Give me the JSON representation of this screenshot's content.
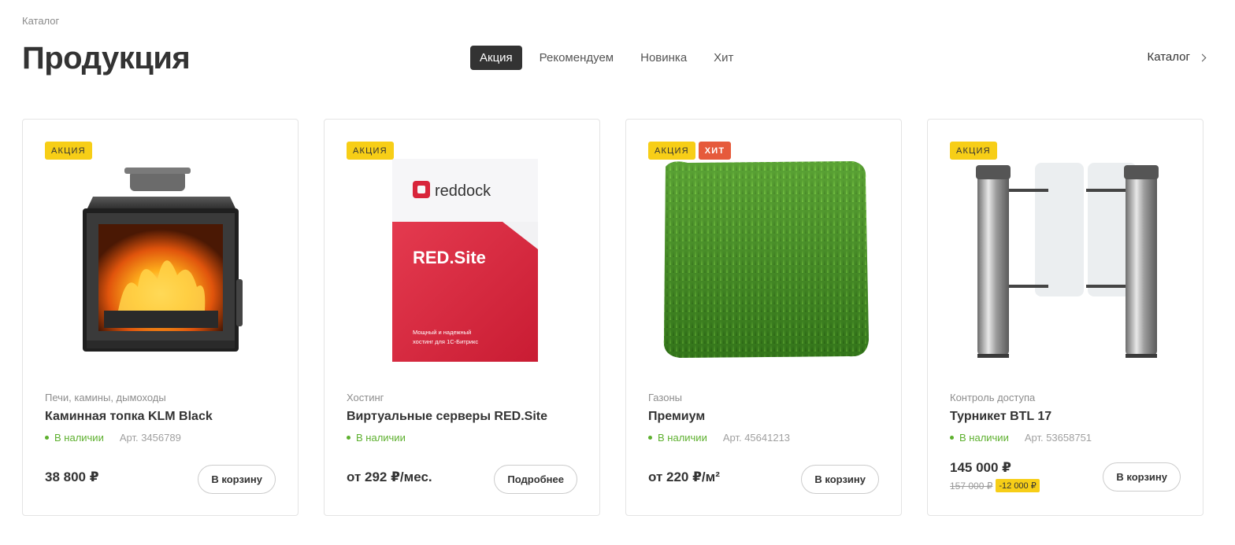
{
  "breadcrumb": "Каталог",
  "title": "Продукция",
  "tabs": [
    {
      "label": "Акция",
      "active": true
    },
    {
      "label": "Рекомендуем",
      "active": false
    },
    {
      "label": "Новинка",
      "active": false
    },
    {
      "label": "Хит",
      "active": false
    }
  ],
  "catalog_link": "Каталог",
  "colors": {
    "accent_dark": "#333333",
    "badge_sale": "#f7ce17",
    "badge_hit": "#e65a3b",
    "in_stock": "#5db02e"
  },
  "products": [
    {
      "badges": [
        "АКЦИЯ"
      ],
      "image_icon": "fireplace-image",
      "category": "Печи, камины, дымоходы",
      "name": "Каминная топка KLM Black",
      "stock": "В наличии",
      "sku": "Арт. 3456789",
      "price": "38 800 ₽",
      "button": "В корзину"
    },
    {
      "badges": [
        "АКЦИЯ"
      ],
      "image_icon": "software-box-image",
      "image_brand": "reddock",
      "image_product": "RED.Site",
      "image_caption_1": "Мощный и надежный",
      "image_caption_2": "хостинг для 1С-Битрикс",
      "category": "Хостинг",
      "name": "Виртуальные серверы RED.Site",
      "stock": "В наличии",
      "price": "от 292 ₽/мес.",
      "button": "Подробнее"
    },
    {
      "badges": [
        "АКЦИЯ",
        "ХИТ"
      ],
      "image_icon": "grass-image",
      "category": "Газоны",
      "name": "Премиум",
      "stock": "В наличии",
      "sku": "Арт. 45641213",
      "price": "от 220 ₽/м²",
      "button": "В корзину"
    },
    {
      "badges": [
        "АКЦИЯ"
      ],
      "image_icon": "turnstile-image",
      "category": "Контроль доступа",
      "name": "Турникет BTL 17",
      "stock": "В наличии",
      "sku": "Арт. 53658751",
      "price": "145 000 ₽",
      "old_price": "157 000 ₽",
      "discount": "-12 000 ₽",
      "button": "В корзину"
    }
  ]
}
